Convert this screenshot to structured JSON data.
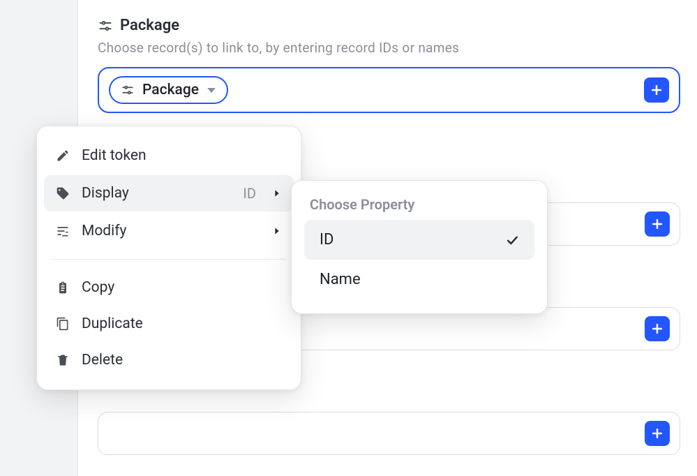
{
  "section": {
    "title": "Package",
    "hint": "Choose record(s) to link to, by entering record IDs or names"
  },
  "token": {
    "label": "Package"
  },
  "menu": {
    "edit_token": "Edit token",
    "display": {
      "label": "Display",
      "value": "ID"
    },
    "modify": "Modify",
    "copy": "Copy",
    "duplicate": "Duplicate",
    "delete": "Delete"
  },
  "submenu": {
    "title": "Choose Property",
    "items": [
      {
        "label": "ID",
        "selected": true
      },
      {
        "label": "Name",
        "selected": false
      }
    ]
  }
}
